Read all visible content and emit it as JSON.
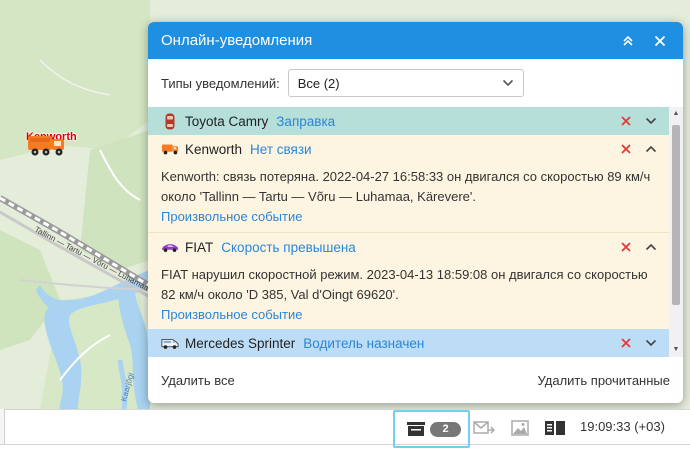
{
  "map": {
    "marker_label": "Kenworth",
    "road_label": "Tallinn — Tartu — Võru — Luhamaa",
    "road_label_2": "Kaarjõgi"
  },
  "panel": {
    "title": "Онлайн-уведомления",
    "filter_label": "Типы уведомлений:",
    "filter_value": "Все (2)",
    "footer_delete_all": "Удалить все",
    "footer_delete_read": "Удалить прочитанные"
  },
  "notifications": [
    {
      "unit": "Toyota Camry",
      "type": "Заправка",
      "icon": "car-icon",
      "expanded": false
    },
    {
      "unit": "Kenworth",
      "type": "Нет связи",
      "icon": "truck-icon",
      "expanded": true,
      "text": "Kenworth: связь потеряна. 2022-04-27 16:58:33 он двигался со скоростью 89 км/ч около 'Tallinn — Tartu — Võru — Luhamaa, Kärevere'.",
      "link": "Произвольное событие"
    },
    {
      "unit": "FIAT",
      "type": "Скорость превышена",
      "icon": "sports-car-icon",
      "expanded": true,
      "text": "FIAT нарушил скоростной режим. 2023-04-13 18:59:08 он двигался со скоростью 82 км/ч около 'D 385, Val d'Oingt 69620'.",
      "link": "Произвольное событие"
    },
    {
      "unit": "Mercedes Sprinter",
      "type": "Водитель назначен",
      "icon": "van-icon",
      "expanded": false
    }
  ],
  "statusbar": {
    "notif_count": "2",
    "time": "19:09:33 (+03)"
  },
  "colors": {
    "accent": "#1e8fe1",
    "link": "#2a86d6",
    "delete": "#e53935",
    "row_green": "#b6dfda",
    "row_cream": "#fdf5e1",
    "row_blue": "#bdddf7"
  }
}
